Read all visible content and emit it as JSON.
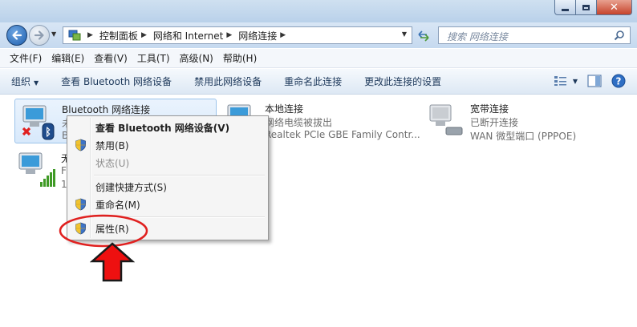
{
  "window": {
    "min_glyph": "",
    "close_glyph": "✕"
  },
  "address": {
    "breadcrumbs": [
      "控制面板",
      "网络和 Internet",
      "网络连接"
    ]
  },
  "search": {
    "placeholder": "搜索 网络连接"
  },
  "menubar": {
    "items": [
      "文件(F)",
      "编辑(E)",
      "查看(V)",
      "工具(T)",
      "高级(N)",
      "帮助(H)"
    ]
  },
  "toolbar": {
    "buttons": [
      "组织",
      "查看 Bluetooth 网络设备",
      "禁用此网络设备",
      "重命名此连接",
      "更改此连接的设置"
    ]
  },
  "connections": [
    {
      "name": "Bluetooth 网络连接",
      "status": "未",
      "device": "B",
      "selected": true
    },
    {
      "name": "本地连接",
      "status": "网络电缆被拔出",
      "device": "Realtek PCIe GBE Family Contr..."
    },
    {
      "name": "宽带连接",
      "status": "已断开连接",
      "device": "WAN 微型端口 (PPPOE)"
    },
    {
      "name": "无",
      "status": "F",
      "device": "1"
    }
  ],
  "context_menu": {
    "items": [
      {
        "label": "查看 Bluetooth 网络设备(V)",
        "bold": true,
        "shield": false,
        "disabled": false
      },
      {
        "label": "禁用(B)",
        "bold": false,
        "shield": true,
        "disabled": false
      },
      {
        "label": "状态(U)",
        "bold": false,
        "shield": false,
        "disabled": true
      },
      {
        "label": "创建快捷方式(S)",
        "bold": false,
        "shield": false,
        "disabled": false
      },
      {
        "label": "重命名(M)",
        "bold": false,
        "shield": true,
        "disabled": false
      },
      {
        "label": "属性(R)",
        "bold": false,
        "shield": true,
        "disabled": false
      }
    ]
  },
  "annotation": {
    "ellipse_color": "#e0201f",
    "arrow_color": "#ee1010"
  },
  "colors": {
    "selection": "#d8e9fb",
    "toolbar_text": "#1e395b",
    "status_text": "#6d6d6d"
  }
}
